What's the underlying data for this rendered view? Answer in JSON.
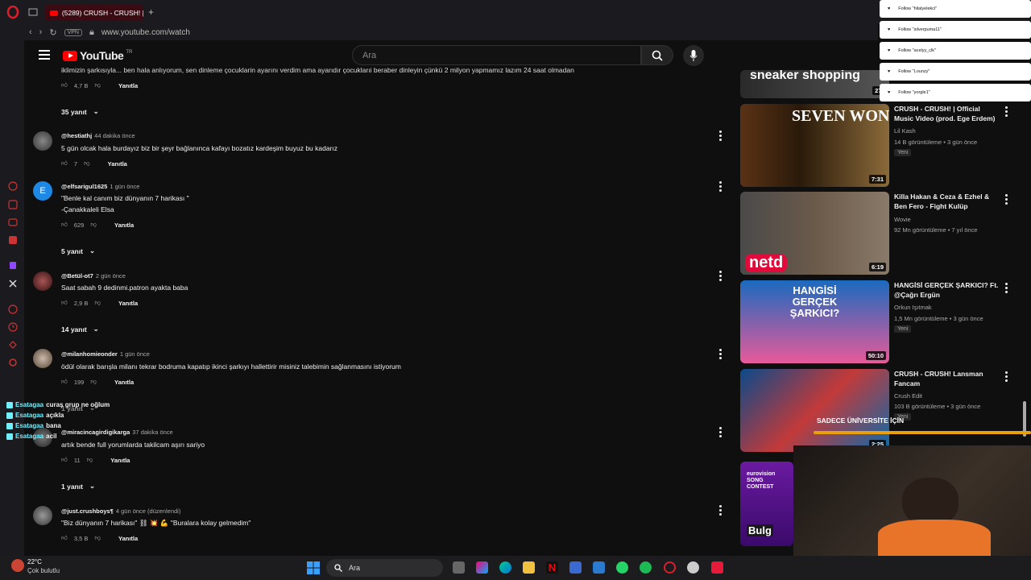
{
  "browser": {
    "tab_title": "(5289) CRUSH - CRUSH! |",
    "url": "www.youtube.com/watch",
    "vpn_label": "VPN"
  },
  "youtube": {
    "logo_text": "YouTube",
    "logo_region": "TR",
    "search_placeholder": "Ara"
  },
  "comments": {
    "top_text": "iklimizin şarkısıyla... ben hala anlıyorum, sen dinleme çocuklarin ayarını verdim ama ayarıdır çocuklarıi beraber dinleyin çünkü 2 milyon yapmamız lazım 24 saat olmadan",
    "top_likes": "4,7 B",
    "reply_label": "Yanıtla",
    "items": [
      {
        "replies_above": "35 yanıt",
        "author": "@hestiathj",
        "time": "44 dakika önce",
        "text": "5 gün olcak hala burdayız biz bir şeyr bağlanınca kafayı bozatız kardeşim buyuz bu kadarız",
        "likes": "7",
        "avatar_letter": ""
      },
      {
        "author": "@elfsarigul1625",
        "time": "1 gün önce",
        "text": "\"Benle kal canım biz dünyanın 7 harikası \"",
        "text2": "-Çanakkaleli Elsa",
        "likes": "629",
        "avatar_letter": "E",
        "replies": "5 yanıt"
      },
      {
        "author": "@Betül-ot7",
        "time": "2 gün önce",
        "text": "Saat sabah 9 dedinmi.patron ayakta baba",
        "likes": "2,9 B",
        "avatar_letter": "",
        "replies": "14 yanıt"
      },
      {
        "author": "@milanhomieonder",
        "time": "1 gün önce",
        "text": "ödül olarak barışla milanı tekrar bodruma kapatıp ikinci şarkıyı hallettirir misiniz talebimin sağlanmasını istiyorum",
        "likes": "199",
        "avatar_letter": "",
        "replies": "1 yanıt"
      },
      {
        "author": "@miracincagirdigikarga",
        "time": "37 dakika önce",
        "text": "artık bende full yorumlarda takilcam aşırı sariyo",
        "likes": "11",
        "avatar_letter": "",
        "replies": "1 yanıt"
      },
      {
        "author": "@just.crushboys¶",
        "time": "4 gün önce (düzenlendi)",
        "text": "\"Biz dünyanın 7 harikası\" ⛓ 💥 💪 \"Buralara kolay gelmedim\"",
        "likes": "3,5 B",
        "avatar_letter": ""
      }
    ]
  },
  "recommendations": {
    "top_banner_text": "sneaker shopping",
    "top_banner_duration": "27:",
    "videos": [
      {
        "thumb_text": "SEVEN WONDERS",
        "duration": "7:31",
        "title": "CRUSH - CRUSH! | Official Music Video (prod. Ege Erdem)",
        "channel": "Lil Kash",
        "meta": "14 B görüntüleme • 3 gün önce",
        "badge": "Yeni"
      },
      {
        "thumb_text": "netd",
        "duration": "6:19",
        "title": "Killa Hakan & Ceza & Ezhel & Ben Fero - Fight Kulüp",
        "channel": "Wovie",
        "meta": "92 Mn görüntüleme • 7 yıl önce",
        "badge": ""
      },
      {
        "thumb_text": "HANGİSİ GERÇEK ŞARKICI?",
        "duration": "50:10",
        "title": "HANGİSİ GERÇEK ŞARKICI? Ft. @Çağrı Ergün",
        "channel": "Orkun Işıtmak",
        "meta": "1,5 Mn görüntüleme • 3 gün önce",
        "badge": "Yeni"
      },
      {
        "thumb_text": "",
        "duration": "2:25",
        "title": "CRUSH - CRUSH! Lansman Fancam",
        "channel": "Crush Edit",
        "meta": "103 B görüntüleme • 3 gün önce",
        "badge": "Yeni"
      },
      {
        "thumb_text": "eurovision SONG CONTEST",
        "duration": "",
        "title": "",
        "channel": "",
        "meta": "",
        "badge": "",
        "thumb_side_text": "Bulg"
      }
    ]
  },
  "overlays": {
    "follows": [
      {
        "label": "Follow \"hilalyelekci\""
      },
      {
        "label": "Follow \"silverpuma11\""
      },
      {
        "label": "Follow \"acelyy_clk\""
      },
      {
        "label": "Follow \"Lounzy\""
      },
      {
        "label": "Follow \"yorgle1\""
      }
    ],
    "chat": [
      {
        "name": "Esatagaa",
        "msg": "curaş grup ne oğlum"
      },
      {
        "name": "Esatagaa",
        "msg": "açıkla"
      },
      {
        "name": "Esatagaa",
        "msg": "bana"
      },
      {
        "name": "Esatagaa",
        "msg": "acil"
      }
    ],
    "banner_text": "SADECE ÜNİVERSİTE İÇİN"
  },
  "taskbar": {
    "weather_temp": "22°C",
    "weather_desc": "Çok bulutlu",
    "search_label": "Ara"
  },
  "colors": {
    "accent": "#ff0000",
    "chat_name": "#6ef0ff",
    "bg": "#0f0f0f"
  }
}
